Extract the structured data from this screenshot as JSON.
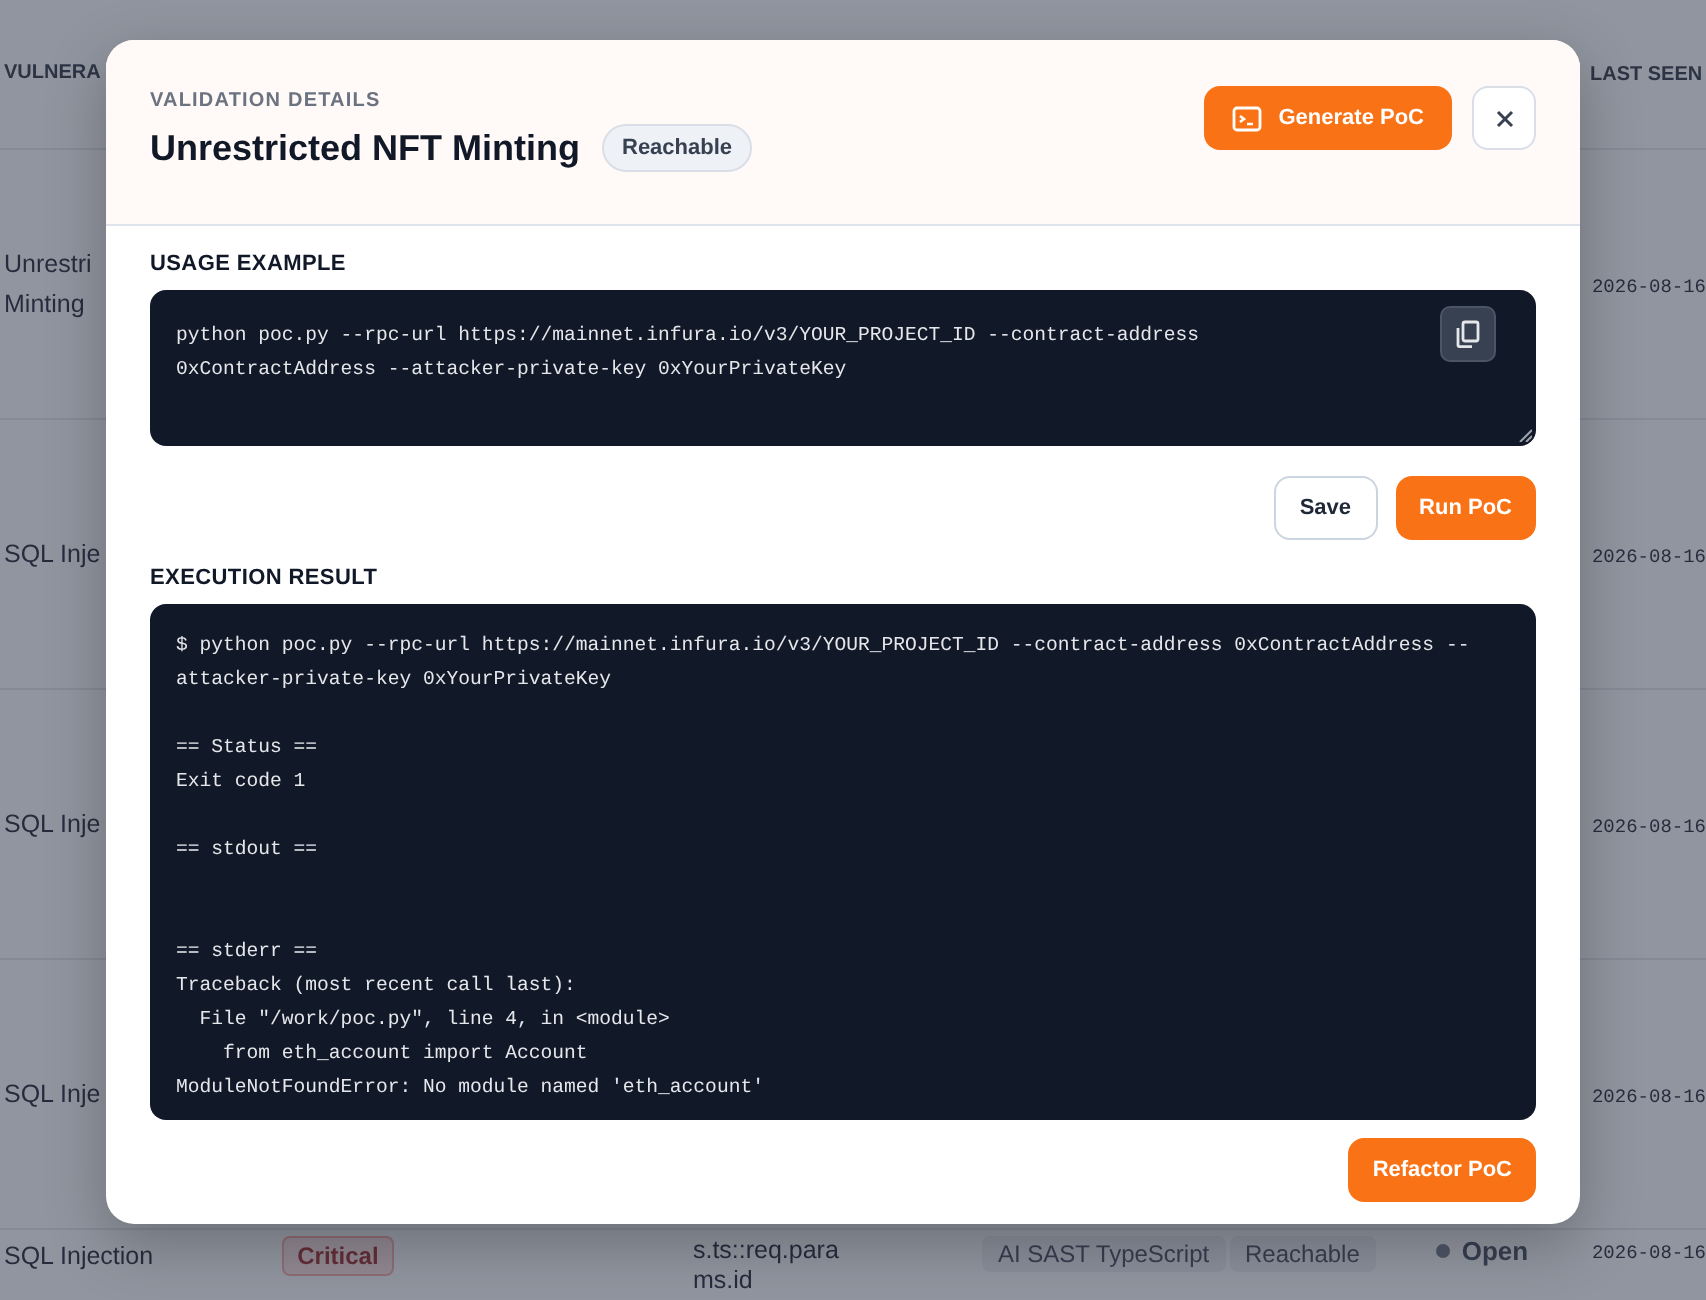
{
  "table": {
    "columns": [
      {
        "label": "VULNERA"
      },
      {
        "label": "LAST SEEN"
      }
    ],
    "rows": [
      {
        "name": "Unrestri\nMinting",
        "last_seen": "2026-08-16"
      },
      {
        "name": "SQL Inje",
        "last_seen": "2026-08-16"
      },
      {
        "name": "SQL Inje",
        "last_seen": "2026-08-16"
      },
      {
        "name": "SQL Inje",
        "last_seen": "2026-08-16"
      },
      {
        "name": "SQL Injection",
        "severity": "Critical",
        "location": "s.ts::req.params.id",
        "tool": "AI SAST TypeScript",
        "reachability": "Reachable",
        "status": "Open",
        "last_seen": "2026-08-16"
      }
    ]
  },
  "modal": {
    "label": "VALIDATION DETAILS",
    "title": "Unrestricted NFT Minting",
    "badge": "Reachable",
    "generate_button": "Generate PoC",
    "usage": {
      "label": "USAGE EXAMPLE",
      "code": "python poc.py --rpc-url https://mainnet.infura.io/v3/YOUR_PROJECT_ID --contract-address\n0xContractAddress --attacker-private-key 0xYourPrivateKey"
    },
    "buttons": [
      {
        "label": "Save",
        "kind": "secondary"
      },
      {
        "label": "Run PoC",
        "kind": "primary"
      }
    ],
    "result": {
      "label": "EXECUTION RESULT",
      "command": [
        "$ python poc.py --rpc-url https://mainnet.infura.io/v3/YOUR_PROJECT_ID --contract-address 0xContractAddress --",
        "attacker-private-key 0xYourPrivateKey"
      ],
      "sections": [
        {
          "header": "== Status ==",
          "lines": [
            "Exit code 1"
          ]
        },
        {
          "header": "== stdout =="
        },
        {
          "header": "== stderr ==",
          "lines": [
            "Traceback (most recent call last):",
            "  File \"/work/poc.py\", line 4, in <module>",
            "    from eth_account import Account",
            "ModuleNotFoundError: No module named 'eth_account'"
          ]
        }
      ]
    },
    "refactor_button": "Refactor PoC"
  }
}
